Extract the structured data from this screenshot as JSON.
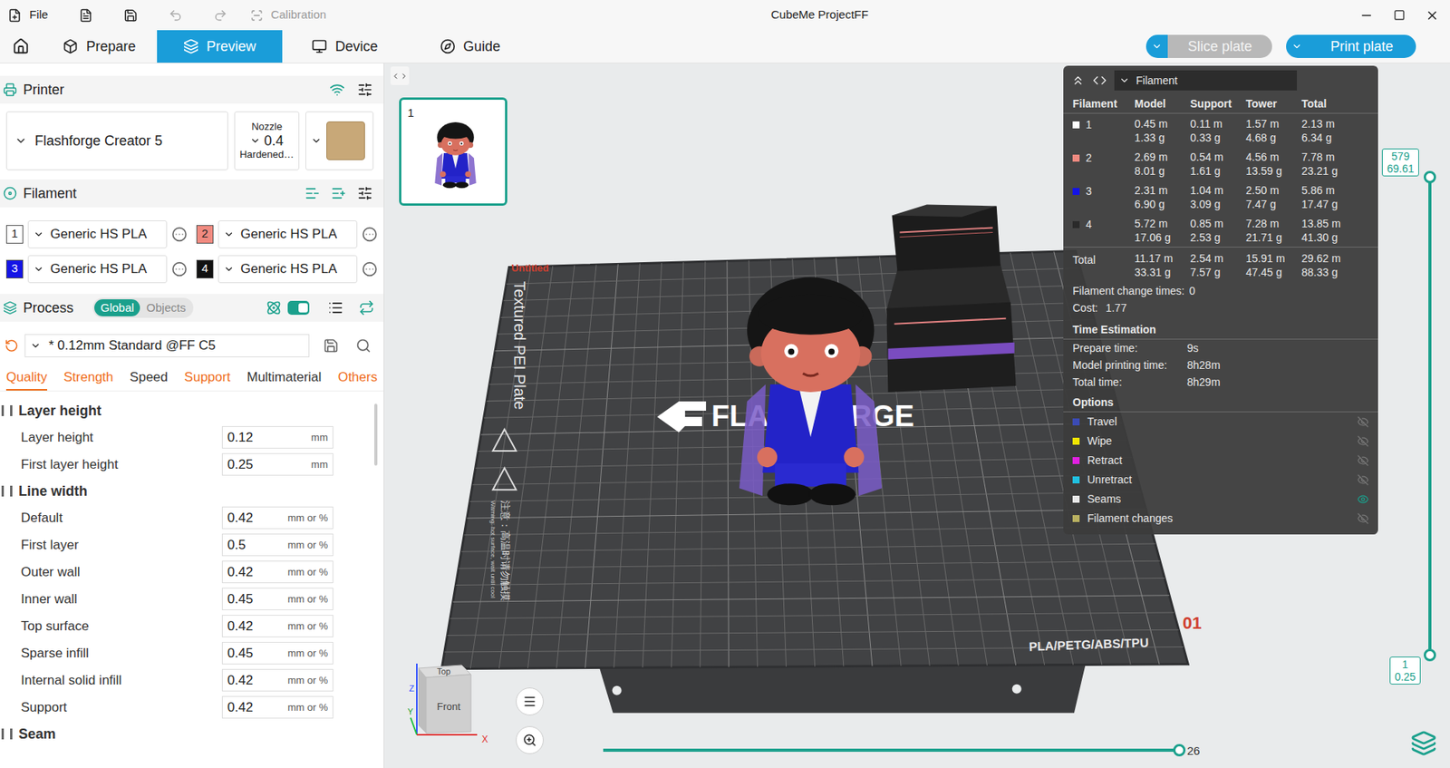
{
  "window": {
    "title": "CubeMe ProjectFF"
  },
  "menu": {
    "file": "File",
    "calibration": "Calibration"
  },
  "tabs": [
    {
      "label": "Prepare",
      "selected": false
    },
    {
      "label": "Preview",
      "selected": true
    },
    {
      "label": "Device",
      "selected": false
    },
    {
      "label": "Guide",
      "selected": false
    }
  ],
  "actions": [
    {
      "label": "Slice plate",
      "disabled": true
    },
    {
      "label": "Print plate",
      "disabled": false
    }
  ],
  "printer": {
    "title": "Printer",
    "name": "Flashforge Creator 5",
    "nozzle_label": "Nozzle",
    "nozzle": "0.4",
    "nozzle_type": "Hardened…"
  },
  "filament": {
    "title": "Filament",
    "slots": [
      {
        "index": "1",
        "name": "Generic HS PLA",
        "color": "#ffffff"
      },
      {
        "index": "2",
        "name": "Generic HS PLA",
        "color": "#f08a80"
      },
      {
        "index": "3",
        "name": "Generic HS PLA",
        "color": "#1414e6"
      },
      {
        "index": "4",
        "name": "Generic HS PLA",
        "color": "#111111"
      }
    ]
  },
  "process": {
    "title": "Process",
    "scope": [
      {
        "label": "Global",
        "selected": true
      },
      {
        "label": "Objects",
        "selected": false
      }
    ],
    "advanced_on": true,
    "preset": "* 0.12mm Standard @FF C5",
    "tabs": [
      {
        "label": "Quality",
        "selected": true,
        "modified": true
      },
      {
        "label": "Strength",
        "selected": false,
        "modified": true
      },
      {
        "label": "Speed",
        "selected": false,
        "modified": false
      },
      {
        "label": "Support",
        "selected": false,
        "modified": true
      },
      {
        "label": "Multimaterial",
        "selected": false,
        "modified": false
      },
      {
        "label": "Others",
        "selected": false,
        "modified": true
      }
    ]
  },
  "settings": [
    {
      "title": "Layer height",
      "rows": [
        {
          "label": "Layer height",
          "value": "0.12",
          "unit": "mm"
        },
        {
          "label": "First layer height",
          "value": "0.25",
          "unit": "mm"
        }
      ]
    },
    {
      "title": "Line width",
      "rows": [
        {
          "label": "Default",
          "value": "0.42",
          "unit": "mm or %"
        },
        {
          "label": "First layer",
          "value": "0.5",
          "unit": "mm or %"
        },
        {
          "label": "Outer wall",
          "value": "0.42",
          "unit": "mm or %"
        },
        {
          "label": "Inner wall",
          "value": "0.45",
          "unit": "mm or %"
        },
        {
          "label": "Top surface",
          "value": "0.42",
          "unit": "mm or %"
        },
        {
          "label": "Sparse infill",
          "value": "0.45",
          "unit": "mm or %"
        },
        {
          "label": "Internal solid infill",
          "value": "0.42",
          "unit": "mm or %"
        },
        {
          "label": "Support",
          "value": "0.42",
          "unit": "mm or %"
        }
      ]
    },
    {
      "title": "Seam",
      "rows": []
    }
  ],
  "plates": [
    {
      "number": "1",
      "selected": true
    }
  ],
  "bed": {
    "name": "Textured PEI Plate",
    "logo": "FLASHFORGE",
    "materials": "PLA/PETG/ABS/TPU",
    "label": "Untitled",
    "number": "01",
    "warning_cn": "注意：高温时请勿触摸",
    "warning_en": "Warning: hot surface, wait until cool"
  },
  "stats": {
    "mode": "Filament",
    "columns": [
      "Filament",
      "Model",
      "Support",
      "Tower",
      "Total"
    ],
    "rows": [
      {
        "id": "1",
        "color": "#ffffff",
        "model": [
          "0.45 m",
          "1.33 g"
        ],
        "support": [
          "0.11 m",
          "0.33 g"
        ],
        "tower": [
          "1.57 m",
          "4.68 g"
        ],
        "total": [
          "2.13 m",
          "6.34 g"
        ]
      },
      {
        "id": "2",
        "color": "#f08a80",
        "model": [
          "2.69 m",
          "8.01 g"
        ],
        "support": [
          "0.54 m",
          "1.61 g"
        ],
        "tower": [
          "4.56 m",
          "13.59 g"
        ],
        "total": [
          "7.78 m",
          "23.21 g"
        ]
      },
      {
        "id": "3",
        "color": "#1414e6",
        "model": [
          "2.31 m",
          "6.90 g"
        ],
        "support": [
          "1.04 m",
          "3.09 g"
        ],
        "tower": [
          "2.50 m",
          "7.47 g"
        ],
        "total": [
          "5.86 m",
          "17.47 g"
        ]
      },
      {
        "id": "4",
        "color": "#2a2a2a",
        "model": [
          "5.72 m",
          "17.06 g"
        ],
        "support": [
          "0.85 m",
          "2.53 g"
        ],
        "tower": [
          "7.28 m",
          "21.71 g"
        ],
        "total": [
          "13.85 m",
          "41.30 g"
        ]
      }
    ],
    "total": {
      "label": "Total",
      "model": [
        "11.17 m",
        "33.31 g"
      ],
      "support": [
        "2.54 m",
        "7.57 g"
      ],
      "tower": [
        "15.91 m",
        "47.45 g"
      ],
      "total": [
        "29.62 m",
        "88.33 g"
      ]
    },
    "changes_label": "Filament change times:",
    "changes": "0",
    "cost_label": "Cost:",
    "cost": "1.77",
    "time_title": "Time Estimation",
    "times": [
      {
        "label": "Prepare time:",
        "value": "9s"
      },
      {
        "label": "Model printing time:",
        "value": "8h28m"
      },
      {
        "label": "Total time:",
        "value": "8h29m"
      }
    ],
    "options_title": "Options",
    "options": [
      {
        "label": "Travel",
        "color": "#3b4bb5",
        "visible": false
      },
      {
        "label": "Wipe",
        "color": "#f2e600",
        "visible": false
      },
      {
        "label": "Retract",
        "color": "#e020e0",
        "visible": false
      },
      {
        "label": "Unretract",
        "color": "#20c0e0",
        "visible": false
      },
      {
        "label": "Seams",
        "color": "#e8e8e8",
        "visible": true
      },
      {
        "label": "Filament changes",
        "color": "#b8b060",
        "visible": false
      }
    ]
  },
  "layer_slider": {
    "top_layer": "579",
    "top_height": "69.61",
    "bottom_layer": "1",
    "bottom_height": "0.25",
    "level": 1
  },
  "move_slider": {
    "value": "26",
    "level": 1
  },
  "view_cube": {
    "top": "Top",
    "front": "Front",
    "x": "X",
    "y": "Y",
    "z": "Z"
  }
}
